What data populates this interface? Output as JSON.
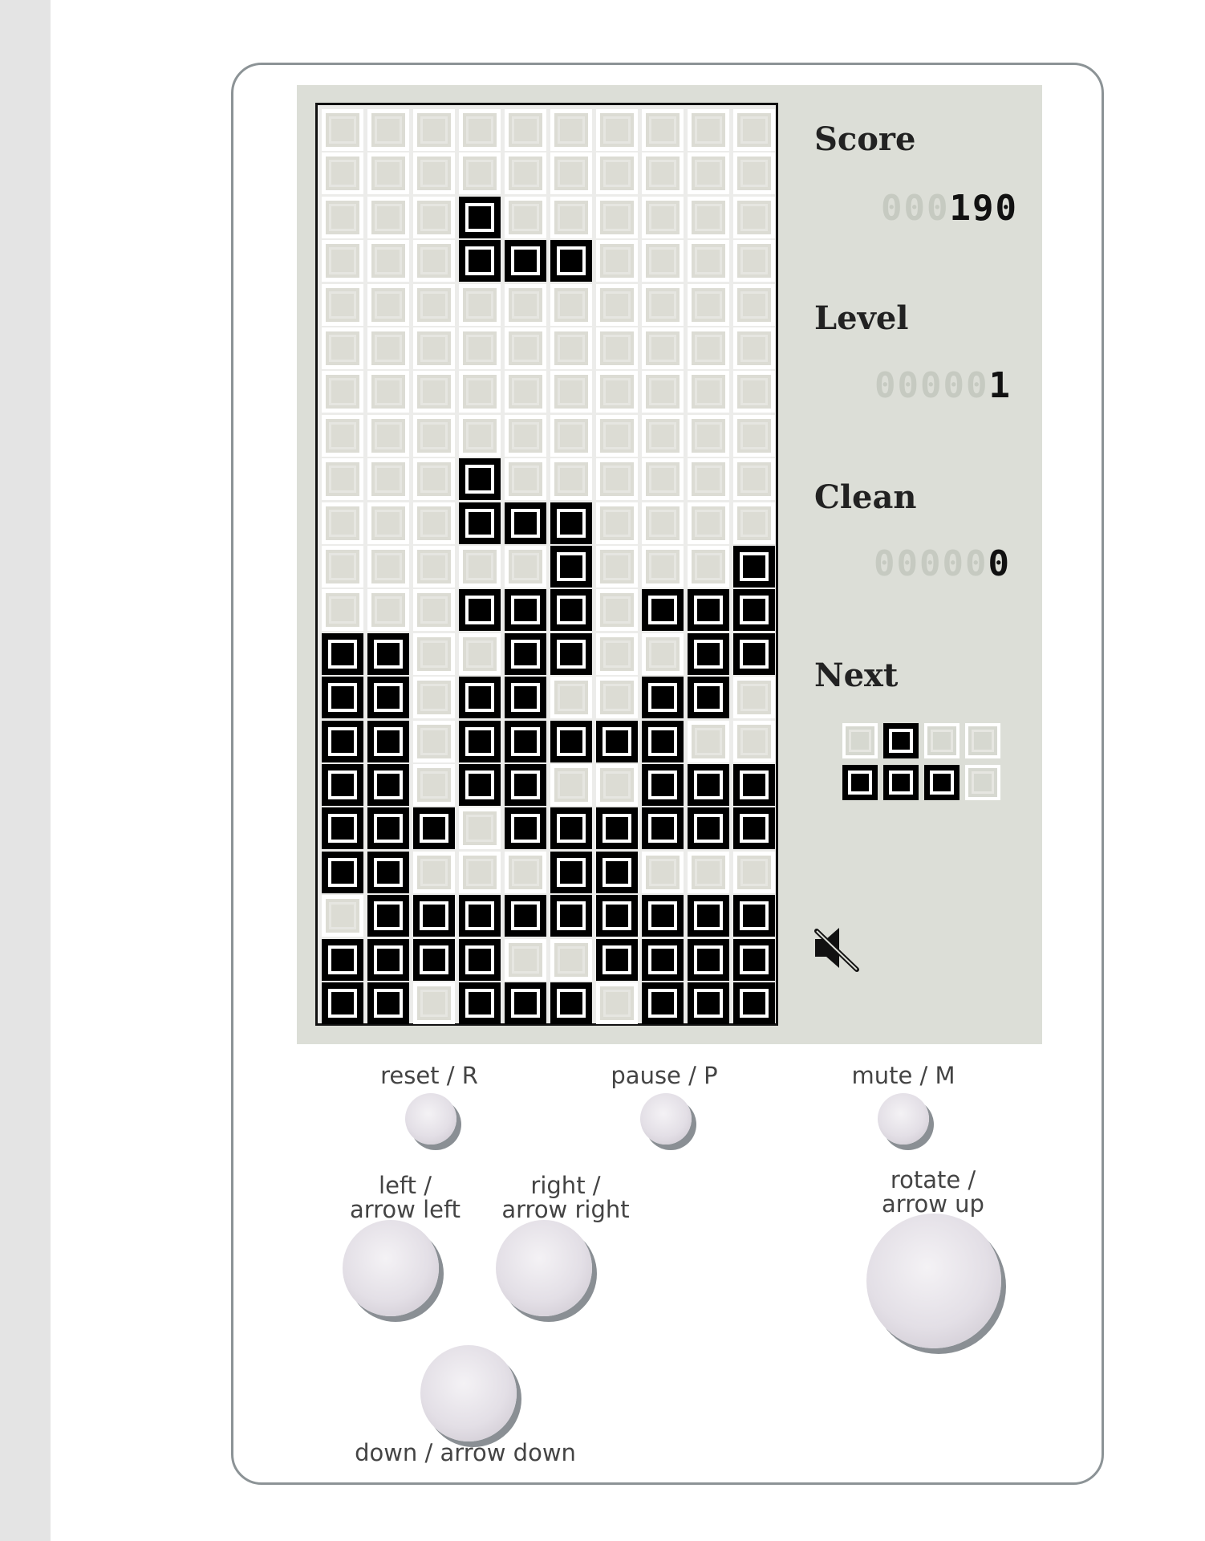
{
  "panel": {
    "score_label": "Score",
    "score_ghost": "000",
    "score_value": "190",
    "level_label": "Level",
    "level_ghost": "00000",
    "level_value": "1",
    "clean_label": "Clean",
    "clean_ghost": "00000",
    "clean_value": "0",
    "next_label": "Next",
    "next_piece": [
      [
        0,
        1,
        0,
        0
      ],
      [
        1,
        1,
        1,
        0
      ]
    ],
    "mute_icon": "speaker-muted-icon"
  },
  "board": [
    "0000000000",
    "0000000000",
    "0001000000",
    "0001110000",
    "0000000000",
    "0000000000",
    "0000000000",
    "0000000000",
    "0001000000",
    "0001110000",
    "0000010001",
    "0001110111",
    "1100110011",
    "1101100110",
    "1101111100",
    "1101100111",
    "1110111111",
    "1100011000",
    "0111111111",
    "1111001111",
    "1101110111"
  ],
  "controls": {
    "reset_label": "reset / R",
    "pause_label": "pause / P",
    "mute_label": "mute / M",
    "left_label_1": "left /",
    "left_label_2": "arrow left",
    "right_label_1": "right /",
    "right_label_2": "arrow right",
    "rotate_label_1": "rotate /",
    "rotate_label_2": "arrow up",
    "down_label": "down / arrow down"
  }
}
